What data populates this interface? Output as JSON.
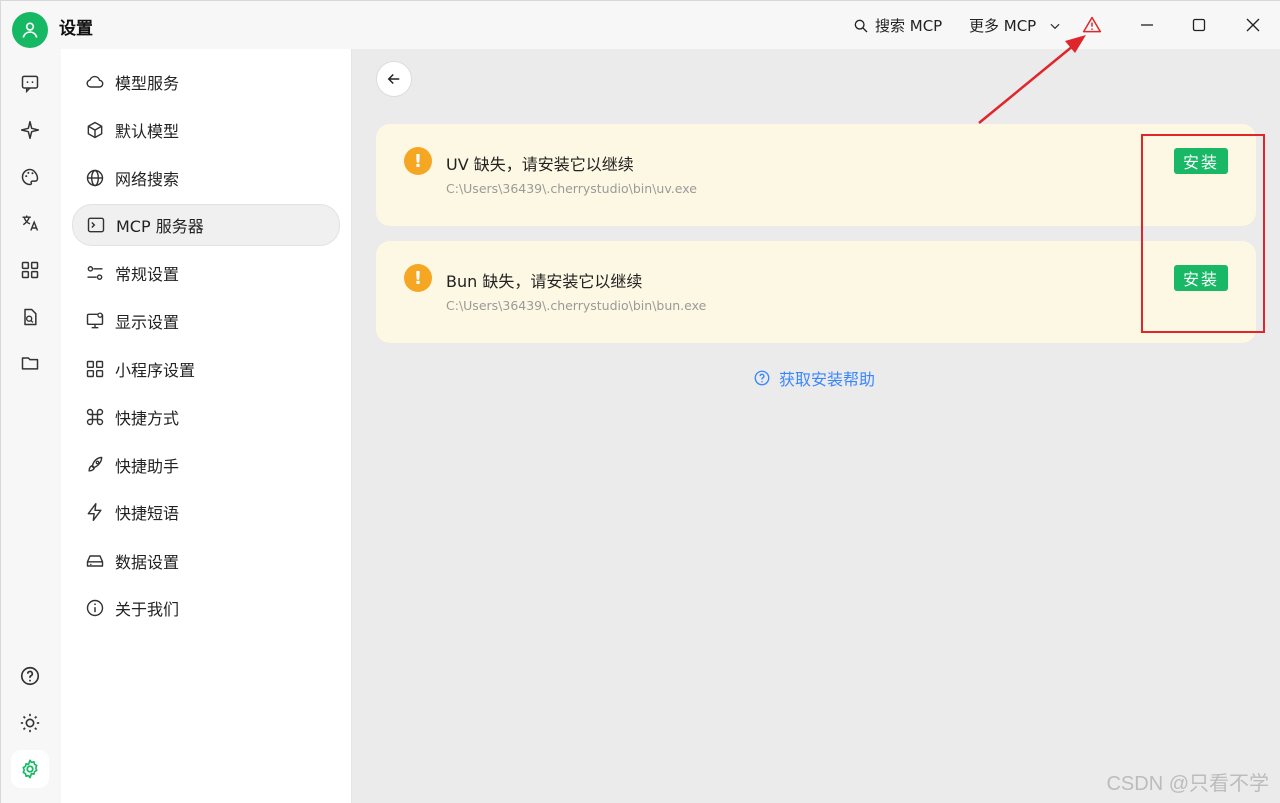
{
  "app": {
    "title": "设置",
    "avatar_color": "#17b864"
  },
  "titlebar": {
    "search_mcp": "搜索 MCP",
    "more_mcp": "更多 MCP",
    "warning_color": "#e0262a"
  },
  "rail": {
    "icons": [
      "chat-icon",
      "sparkle-icon",
      "palette-icon",
      "translate-icon",
      "apps-grid-icon",
      "document-search-icon",
      "folder-icon",
      "help-icon",
      "brightness-icon",
      "settings-gear-icon"
    ],
    "active": "settings-gear-icon"
  },
  "menu": {
    "items": [
      {
        "label": "模型服务",
        "icon": "cloud-icon"
      },
      {
        "label": "默认模型",
        "icon": "cube-icon"
      },
      {
        "label": "网络搜索",
        "icon": "globe-icon"
      },
      {
        "label": "MCP 服务器",
        "icon": "terminal-icon"
      },
      {
        "label": "常规设置",
        "icon": "sliders-icon"
      },
      {
        "label": "显示设置",
        "icon": "monitor-icon"
      },
      {
        "label": "小程序设置",
        "icon": "grid-icon"
      },
      {
        "label": "快捷方式",
        "icon": "command-icon"
      },
      {
        "label": "快捷助手",
        "icon": "rocket-icon"
      },
      {
        "label": "快捷短语",
        "icon": "lightning-icon"
      },
      {
        "label": "数据设置",
        "icon": "drive-icon"
      },
      {
        "label": "关于我们",
        "icon": "info-icon"
      }
    ],
    "active_index": 3
  },
  "main": {
    "cards": [
      {
        "title": "UV 缺失，请安装它以继续",
        "path": "C:\\Users\\36439\\.cherrystudio\\bin\\uv.exe",
        "button": "安装"
      },
      {
        "title": "Bun 缺失，请安装它以继续",
        "path": "C:\\Users\\36439\\.cherrystudio\\bin\\bun.exe",
        "button": "安装"
      }
    ],
    "help_link": "获取安装帮助",
    "accent": "#18b866",
    "card_bg": "#fdf8e3"
  },
  "watermark": "CSDN @只看不学"
}
